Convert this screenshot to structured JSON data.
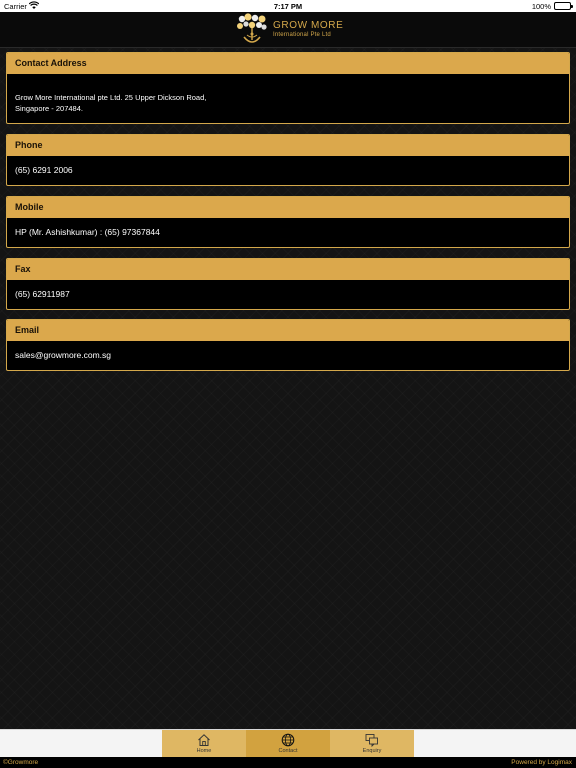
{
  "status_bar": {
    "carrier": "Carrier",
    "time": "7:17 PM",
    "battery": "100%"
  },
  "header": {
    "logo_title": "GROW MORE",
    "logo_subtitle": "International Pte Ltd"
  },
  "cards": {
    "address": {
      "title": "Contact Address",
      "line1": "Grow More International pte Ltd. 25 Upper Dickson Road,",
      "line2": "Singapore - 207484."
    },
    "phone": {
      "title": "Phone",
      "value": "(65) 6291 2006"
    },
    "mobile": {
      "title": "Mobile",
      "value": "HP (Mr. Ashishkumar) : (65) 97367844"
    },
    "fax": {
      "title": "Fax",
      "value": "(65) 62911987"
    },
    "email": {
      "title": "Email",
      "value": "sales@growmore.com.sg"
    }
  },
  "tabs": {
    "home": {
      "label": "Home",
      "icon": "home-icon"
    },
    "contact": {
      "label": "Contact",
      "icon": "globe-icon"
    },
    "enquiry": {
      "label": "Enquiry",
      "icon": "chat-bubbles-icon"
    }
  },
  "footer": {
    "copyright": "©Growmore",
    "powered_by": "Powered by Logimax"
  },
  "colors": {
    "accent": "#dba84c",
    "background": "#141414",
    "card_body": "#000000"
  }
}
